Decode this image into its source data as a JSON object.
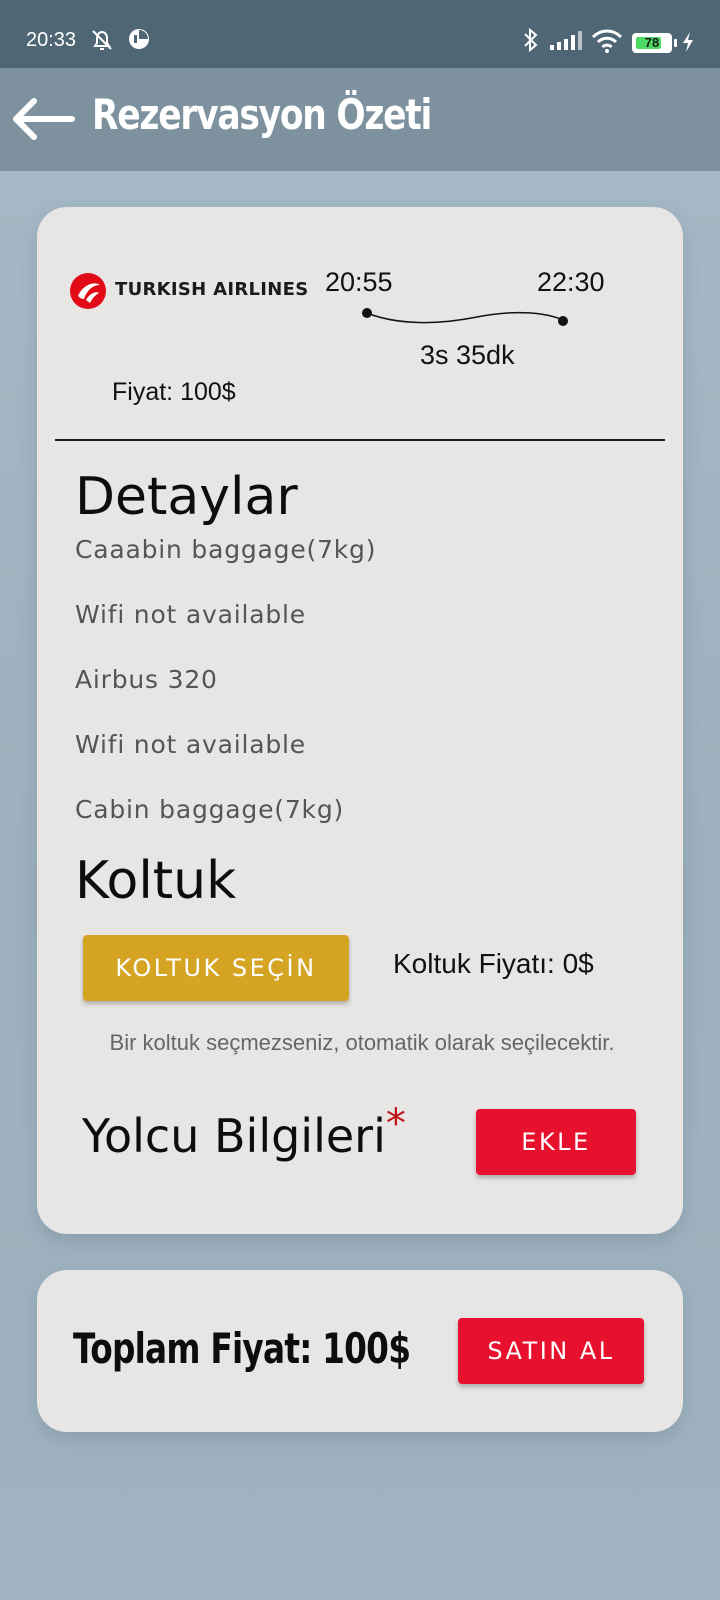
{
  "status_bar": {
    "time": "20:33",
    "battery_level": "78",
    "battery_fraction": 0.78,
    "icons": [
      "alarm-off-icon",
      "app-status-icon",
      "bluetooth-icon",
      "signal-icon",
      "wifi-icon",
      "battery-icon",
      "charging-icon"
    ]
  },
  "app_bar": {
    "title": "Rezervasyon Özeti",
    "back_icon": "arrow-left-icon"
  },
  "flight": {
    "airline": "TURKISH AIRLINES",
    "departure_time": "20:55",
    "arrival_time": "22:30",
    "duration": "3s 35dk",
    "price": "Fiyat: 100$"
  },
  "details": {
    "title": "Detaylar",
    "items": [
      "Caaabin baggage(7kg)",
      "Wifi not available",
      "Airbus 320",
      "Wifi not available",
      "Cabin baggage(7kg)"
    ]
  },
  "seat": {
    "title": "Koltuk",
    "select_button": "KOLTUK SEÇİN",
    "price": "Koltuk Fiyatı: 0$",
    "note": "Bir koltuk seçmezseniz, otomatik olarak seçilecektir."
  },
  "passenger": {
    "title": "Yolcu Bilgileri",
    "required_mark": "*",
    "add_button": "EKLE"
  },
  "total": {
    "label": "Toplam Fiyat: 100$",
    "buy_button": "SATIN AL"
  },
  "colors": {
    "status_bar": "#4f6775",
    "app_bar": "#7d929e",
    "card": "#e8e6e5",
    "seat_button": "#d4a422",
    "primary_red": "#e8112d"
  }
}
